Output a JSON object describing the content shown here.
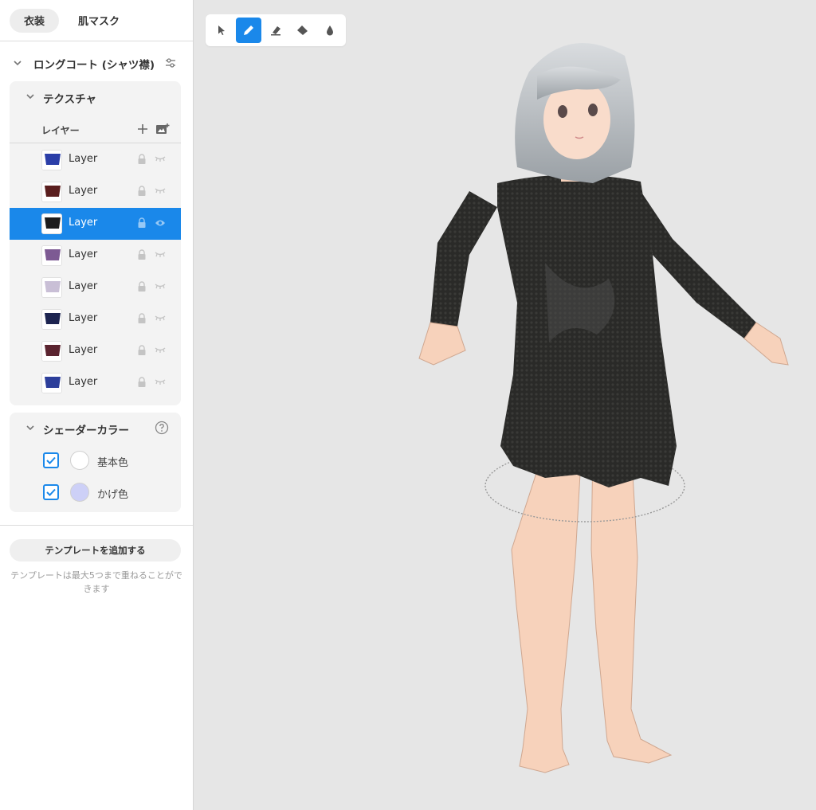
{
  "tabs": {
    "costume": "衣装",
    "skin_mask": "肌マスク"
  },
  "item": {
    "title": "ロングコート (シャツ襟)"
  },
  "texture": {
    "title": "テクスチャ",
    "layers_label": "レイヤー",
    "layers": [
      {
        "name": "Layer",
        "color": "#2b3ea8"
      },
      {
        "name": "Layer",
        "color": "#5a1e1e"
      },
      {
        "name": "Layer",
        "color": "#1c1c1c"
      },
      {
        "name": "Layer",
        "color": "#7d5a93"
      },
      {
        "name": "Layer",
        "color": "#c9bfd6"
      },
      {
        "name": "Layer",
        "color": "#1d2450"
      },
      {
        "name": "Layer",
        "color": "#5b2430"
      },
      {
        "name": "Layer",
        "color": "#2d3f9b"
      }
    ],
    "selected_index": 2
  },
  "shader": {
    "title": "シェーダーカラー",
    "colors": [
      {
        "label": "基本色",
        "color": "#ffffff",
        "checked": true
      },
      {
        "label": "かげ色",
        "color": "#cdd0f7",
        "checked": true
      }
    ]
  },
  "template": {
    "add_button": "テンプレートを追加する",
    "note": "テンプレートは最大5つまで重ねることができます"
  },
  "toolbar": {
    "tools": [
      "select-tool",
      "pen-tool",
      "eraser-tool",
      "fill-tool",
      "dropper-tool"
    ],
    "active": "pen-tool"
  },
  "colors": {
    "accent": "#1a88ea",
    "canvas_bg": "#e6e6e6"
  }
}
